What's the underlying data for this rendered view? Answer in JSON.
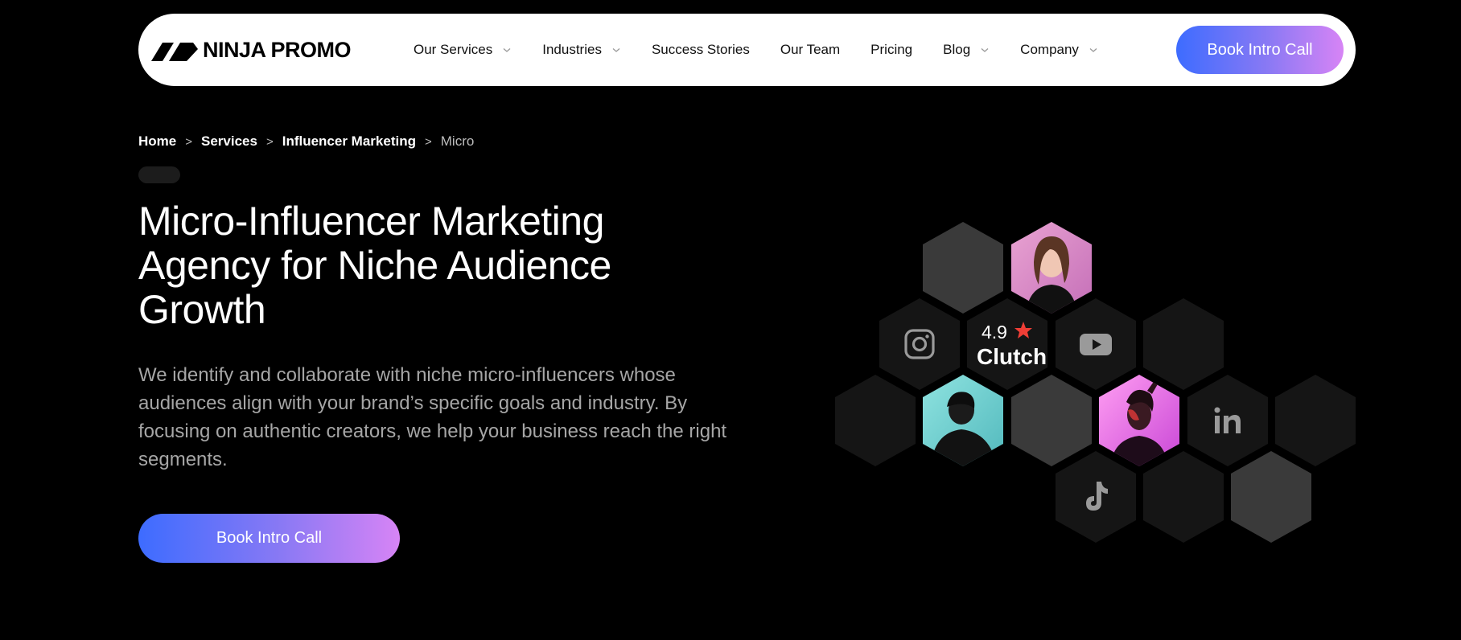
{
  "brand": {
    "name": "NINJA PROMO"
  },
  "nav": {
    "items": [
      {
        "label": "Our Services",
        "dropdown": true
      },
      {
        "label": "Industries",
        "dropdown": true
      },
      {
        "label": "Success Stories",
        "dropdown": false
      },
      {
        "label": "Our Team",
        "dropdown": false
      },
      {
        "label": "Pricing",
        "dropdown": false
      },
      {
        "label": "Blog",
        "dropdown": true
      },
      {
        "label": "Company",
        "dropdown": true
      }
    ],
    "cta_label": "Book Intro Call"
  },
  "breadcrumb": {
    "items": [
      "Home",
      "Services",
      "Influencer Marketing"
    ],
    "current": "Micro",
    "separator": ">"
  },
  "hero": {
    "title": "Micro-Influencer Marketing Agency for Niche Audience Growth",
    "description": "We identify and collaborate with niche micro-influencers whose audiences align with your brand’s specific goals and industry. By focusing on authentic creators, we help your business reach the right segments.",
    "cta_label": "Book Intro Call"
  },
  "clutch": {
    "rating": "4.9",
    "name": "Clutch"
  },
  "colors": {
    "gradient_start": "#3d6cff",
    "gradient_end": "#d784f5",
    "clutch_star": "#ef3e36",
    "hex_dark": "#151515",
    "hex_mid": "#3a3a3a"
  },
  "icons": {
    "social": [
      "instagram-icon",
      "youtube-icon",
      "linkedin-icon",
      "tiktok-icon"
    ],
    "avatars": [
      "influencer-avatar-pink",
      "influencer-avatar-teal",
      "influencer-avatar-magenta"
    ]
  }
}
